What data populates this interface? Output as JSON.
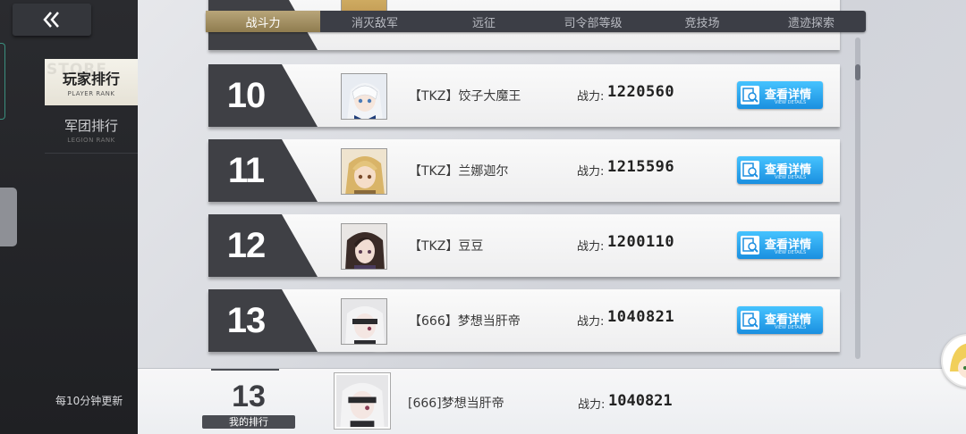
{
  "sidebar": {
    "back_icon": "double-chevron-left-icon",
    "tabs": [
      {
        "label": "玩家排行",
        "sub": "PLAYER RANK",
        "active": true
      },
      {
        "label": "军团排行",
        "sub": "LEGION RANK",
        "active": false
      }
    ],
    "update_note": "每10分钟更新"
  },
  "category_tabs": [
    {
      "label": "战斗力",
      "active": true
    },
    {
      "label": "消灭敌军",
      "active": false
    },
    {
      "label": "远征",
      "active": false
    },
    {
      "label": "司令部等级",
      "active": false
    },
    {
      "label": "竞技场",
      "active": false
    },
    {
      "label": "遗迹探索",
      "active": false
    }
  ],
  "rankings": [
    {
      "rank": "10",
      "name": "【TKZ】饺子大魔王",
      "power_label": "战力:",
      "power": "1220560",
      "button": "查看详情",
      "button_sub": "VIEW DETAILS"
    },
    {
      "rank": "11",
      "name": "【TKZ】兰娜迦尔",
      "power_label": "战力:",
      "power": "1215596",
      "button": "查看详情",
      "button_sub": "VIEW DETAILS"
    },
    {
      "rank": "12",
      "name": "【TKZ】豆豆",
      "power_label": "战力:",
      "power": "1200110",
      "button": "查看详情",
      "button_sub": "VIEW DETAILS"
    },
    {
      "rank": "13",
      "name": "【666】梦想当肝帝",
      "power_label": "战力:",
      "power": "1040821",
      "button": "查看详情",
      "button_sub": "VIEW DETAILS"
    }
  ],
  "my_rank": {
    "rank": "13",
    "label": "我的排行",
    "name": "[666]梦想当肝帝",
    "power_label": "战力:",
    "power": "1040821"
  },
  "colors": {
    "active_tab": "#a8946a",
    "detail_button": "#2aa8f2",
    "rank_plate": "#3f4045"
  }
}
